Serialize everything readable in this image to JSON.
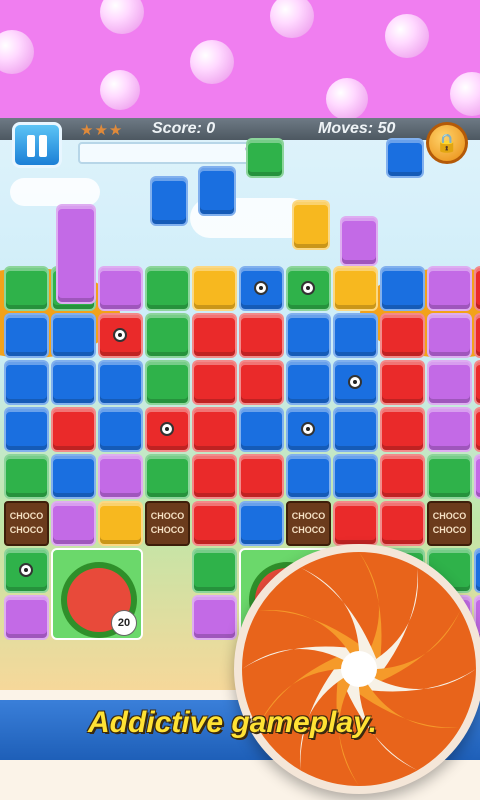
{
  "hud": {
    "stars": "★★★",
    "score_label": "Score: 0",
    "moves_label": "Moves: 50",
    "lock_symbol": "🔒",
    "progress_fraction": 0.0
  },
  "board_items": {
    "chocolate_label": "CHOCO CHOCO",
    "melon_count": "20"
  },
  "caption": "Addictive gameplay.",
  "colors": {
    "red": "#ea2a2a",
    "blue": "#1a6fe0",
    "green": "#2fb24a",
    "purple": "#c36ae6",
    "yellow": "#f7b81f",
    "banner": "#f07ef0",
    "caption": "#ffe234"
  },
  "icons": [
    "pause-icon",
    "lock-icon",
    "grape-icon",
    "eye-icon",
    "watermelon-icon",
    "swirl-candy-icon"
  ]
}
